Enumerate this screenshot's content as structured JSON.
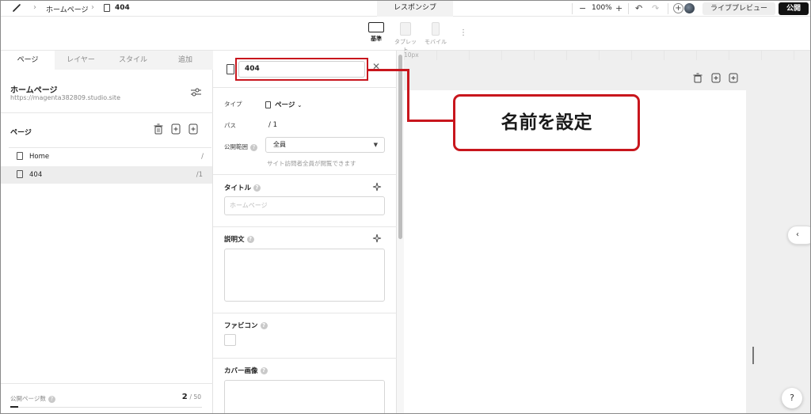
{
  "topbar": {
    "breadcrumb_home": "ホームページ",
    "breadcrumb_page": "404",
    "responsive_label": "レスポンシブ",
    "zoom_level": "100%",
    "zoom_out": "−",
    "zoom_in": "+",
    "add": "+",
    "preview_label": "ライブプレビュー",
    "publish_label": "公開"
  },
  "devices": [
    {
      "label": "基準"
    },
    {
      "label": "タブレット"
    },
    {
      "label": "モバイル"
    }
  ],
  "device_more": "⋮",
  "left_panel": {
    "tabs": [
      "ページ",
      "レイヤー",
      "スタイル",
      "追加"
    ],
    "site_title": "ホームページ",
    "site_url": "https://magenta382809.studio.site",
    "pages_section_title": "ページ",
    "pages": [
      {
        "name": "Home",
        "path": "/"
      },
      {
        "name": "404",
        "path": "/1"
      }
    ],
    "footer_label": "公開ページ数",
    "footer_count": "2",
    "footer_total": "/ 50",
    "help_mark": "?"
  },
  "settings_panel": {
    "page_name_value": "404",
    "close_symbol": "✕",
    "type_label": "タイプ",
    "type_value": "ページ",
    "path_label": "パス",
    "path_value": "/ 1",
    "visibility_label": "公開範囲",
    "visibility_value": "全員",
    "visibility_hint": "サイト訪問者全員が閲覧できます",
    "title_label": "タイトル",
    "title_placeholder": "ホームページ",
    "description_label": "説明文",
    "favicon_label": "ファビコン",
    "cover_label": "カバー画像"
  },
  "canvas": {
    "ruler_label": "10px",
    "collapse_symbol": "‹",
    "help_symbol": "?"
  },
  "annotation": {
    "callout_text": "名前を設定",
    "color": "#c8161d"
  }
}
